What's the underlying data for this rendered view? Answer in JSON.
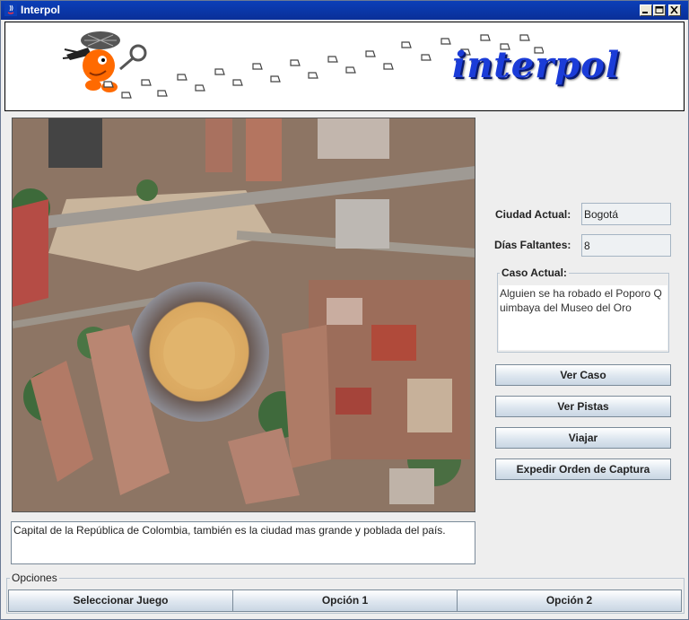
{
  "window": {
    "title": "Interpol"
  },
  "banner": {
    "logo_text": "interpol"
  },
  "city": {
    "description": "Capital de la República de Colombia, también es la ciudad mas grande y poblada del país."
  },
  "status": {
    "current_city_label": "Ciudad Actual:",
    "current_city_value": "Bogotá",
    "days_left_label": "Días Faltantes:",
    "days_left_value": "8",
    "case_label": "Caso Actual:",
    "case_text": "Alguien se ha robado el Poporo Quimbaya del Museo del Oro"
  },
  "actions": {
    "view_case": "Ver Caso",
    "view_clues": "Ver Pistas",
    "travel": "Viajar",
    "issue_warrant": "Expedir Orden de Captura"
  },
  "options": {
    "label": "Opciones",
    "select_game": "Seleccionar Juego",
    "option1": "Opción 1",
    "option2": "Opción 2"
  }
}
